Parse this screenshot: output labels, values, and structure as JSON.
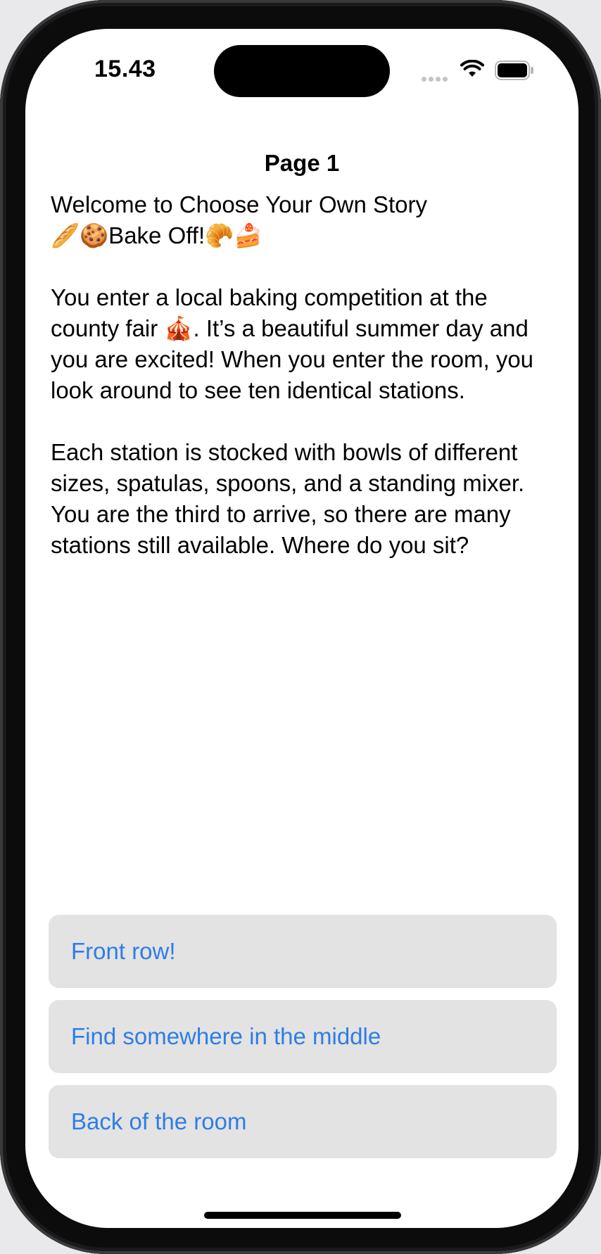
{
  "status_bar": {
    "time": "15.43"
  },
  "icons": {
    "signal": "cellular-signal-icon",
    "wifi": "wifi-icon",
    "battery": "battery-icon"
  },
  "nav": {
    "title": "Page 1"
  },
  "story": {
    "text": "Welcome to Choose Your Own Story\n🥖🍪Bake Off!🥐🍰\n\nYou enter a local baking competition at the county fair 🎪. It’s a beautiful summer day and you are excited! When you enter the room, you look around to see ten identical stations.\n\nEach station is stocked with bowls of different sizes, spatulas, spoons, and a standing mixer. You are the third to arrive, so there are many stations still available. Where do you sit?"
  },
  "choices": [
    {
      "label": "Front row!"
    },
    {
      "label": "Find somewhere in the middle"
    },
    {
      "label": "Back of the room"
    }
  ],
  "colors": {
    "accent": "#2f7de3",
    "button_background": "#e3e3e4",
    "screen_background": "#ffffff"
  }
}
